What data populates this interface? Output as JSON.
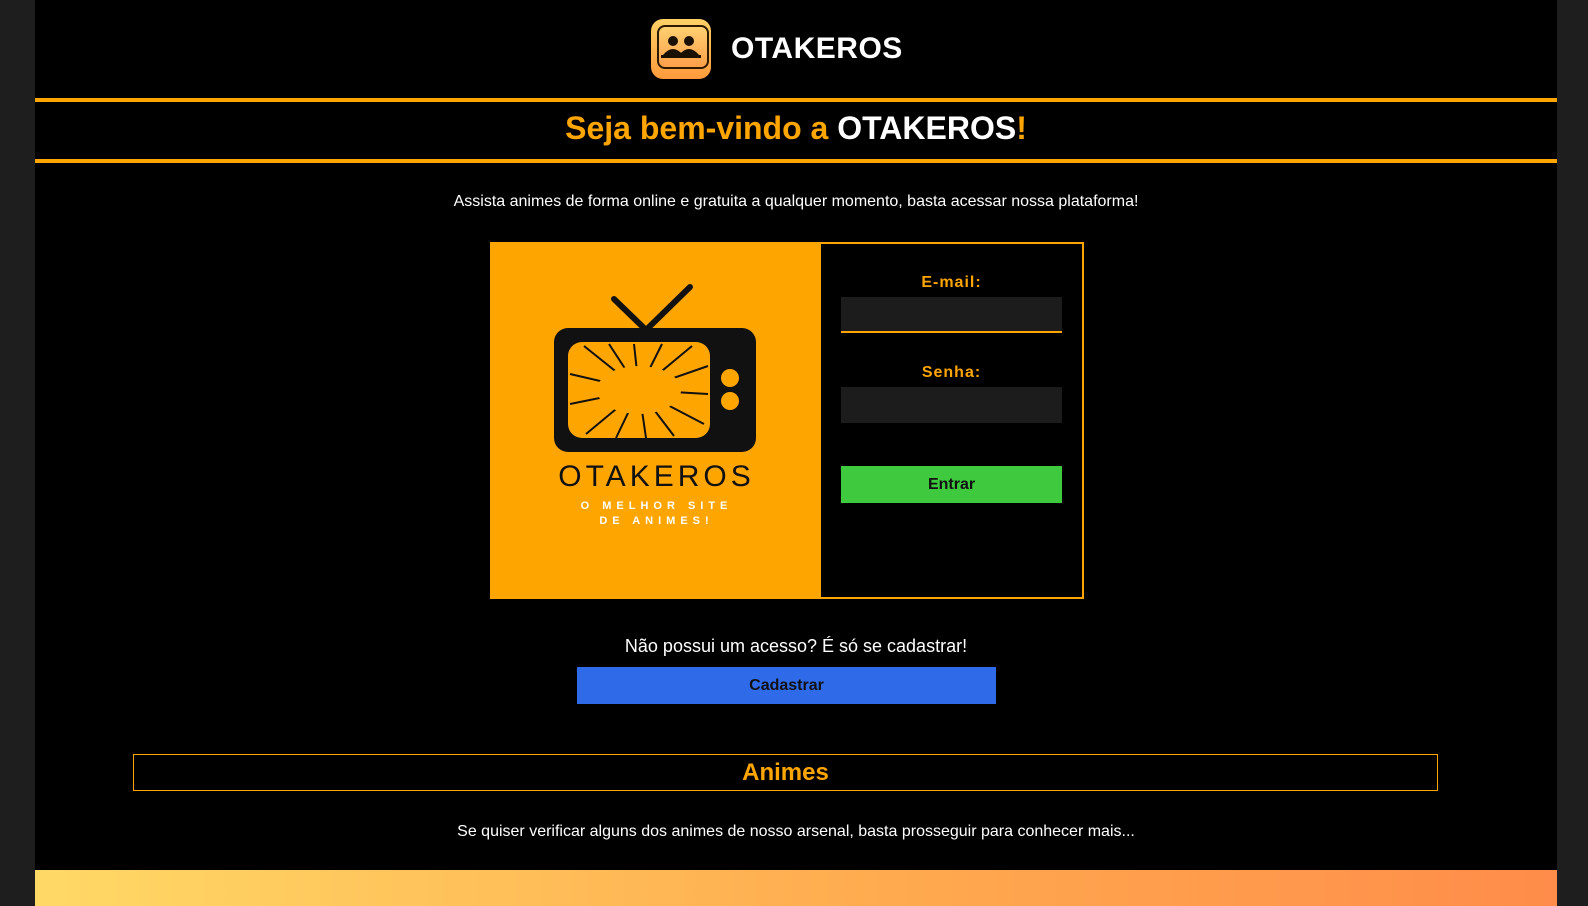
{
  "header": {
    "brand_name": "OTAKEROS"
  },
  "hero": {
    "welcome_prefix": "Seja bem-vindo a ",
    "welcome_brand": "OTAKEROS",
    "welcome_suffix": "!",
    "intro": "Assista animes de forma online e gratuita a qualquer momento, basta acessar nossa plataforma!"
  },
  "promo": {
    "title": "OTAKEROS",
    "tagline_line1": "O MELHOR SITE",
    "tagline_line2": "DE ANIMES!"
  },
  "login": {
    "email_label": "E-mail:",
    "email_value": "",
    "password_label": "Senha:",
    "password_value": "",
    "submit_label": "Entrar"
  },
  "signup": {
    "prompt": "Não possui um acesso? É só se cadastrar!",
    "button_label": "Cadastrar"
  },
  "animes_section": {
    "heading": "Animes",
    "text": "Se quiser verificar alguns dos animes de nosso arsenal, basta prosseguir para conhecer mais..."
  },
  "colors": {
    "accent": "#ffa500",
    "login_button": "#3ec93e",
    "signup_button": "#2f6be8",
    "background": "#000000"
  },
  "icons": {
    "brand": "community-logo-icon",
    "promo": "retro-tv-icon"
  }
}
